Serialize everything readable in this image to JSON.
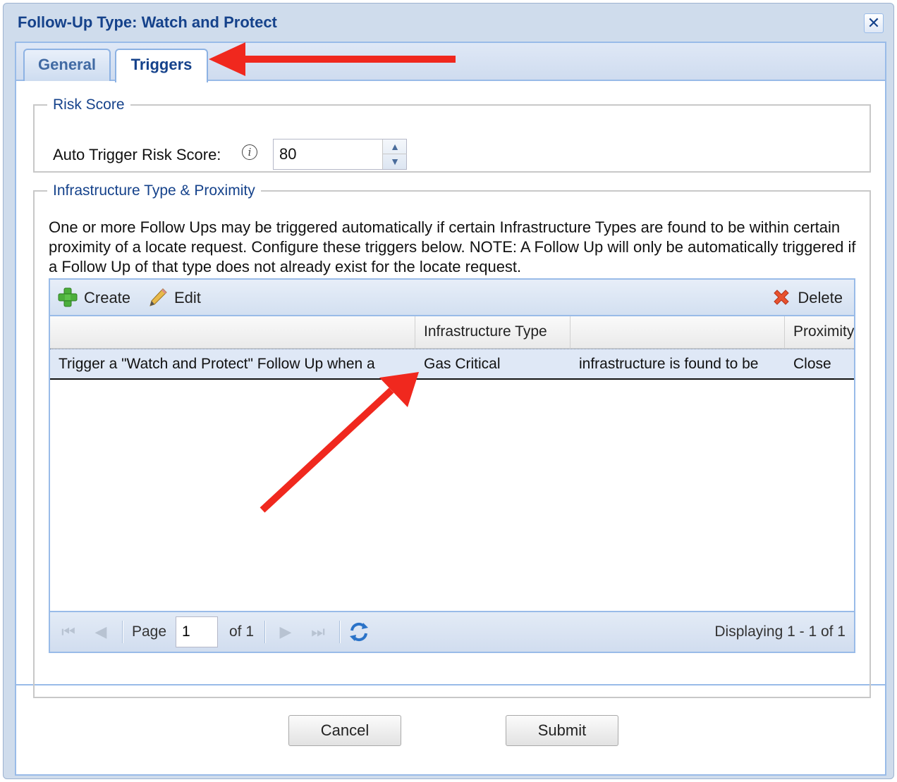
{
  "window": {
    "title": "Follow-Up Type: Watch and Protect",
    "close_glyph": "✕"
  },
  "tabs": [
    {
      "label": "General",
      "active": false
    },
    {
      "label": "Triggers",
      "active": true
    }
  ],
  "risk_score": {
    "legend": "Risk Score",
    "label": "Auto Trigger Risk Score:",
    "info_glyph": "i",
    "value": "80"
  },
  "infrastructure": {
    "legend": "Infrastructure Type & Proximity",
    "description": "One or more Follow Ups may be triggered automatically if certain Infrastructure Types are found to be within certain proximity of a locate request. Configure these triggers below. NOTE: A Follow Up will only be automatically triggered if a Follow Up of that type does not already exist for the locate request."
  },
  "toolbar": {
    "create_label": "Create",
    "edit_label": "Edit",
    "delete_label": "Delete"
  },
  "grid": {
    "columns": [
      "",
      "Infrastructure Type",
      "",
      "Proximity"
    ],
    "rows": [
      [
        "Trigger a \"Watch and Protect\" Follow Up when a",
        "Gas Critical",
        "infrastructure is found to be",
        "Close"
      ]
    ]
  },
  "pager": {
    "page_label": "Page",
    "page_value": "1",
    "of_label": "of 1",
    "display_text": "Displaying 1 - 1 of 1"
  },
  "buttons": {
    "cancel": "Cancel",
    "submit": "Submit"
  },
  "colors": {
    "title": "#15428b",
    "accent_border": "#99bbe8",
    "annotation_arrow": "#f0281e"
  }
}
